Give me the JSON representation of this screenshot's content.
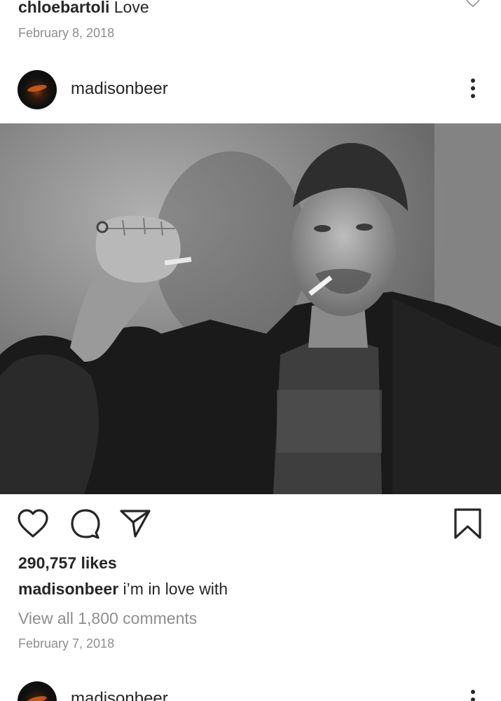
{
  "previous_post": {
    "caption_user": "chloebartoli",
    "caption_text": " Love",
    "date": "February 8, 2018"
  },
  "post": {
    "username": "madisonbeer",
    "likes": "290,757 likes",
    "caption_user": "madisonbeer",
    "caption_text": " i’m in love with",
    "comments_link": "View all 1,800 comments",
    "date": "February 7, 2018"
  },
  "next_post": {
    "username": "madisonbeer"
  },
  "icons": {
    "like": "heart-icon",
    "comment": "comment-icon",
    "share": "send-icon",
    "save": "bookmark-icon",
    "more": "more-vertical-icon"
  }
}
